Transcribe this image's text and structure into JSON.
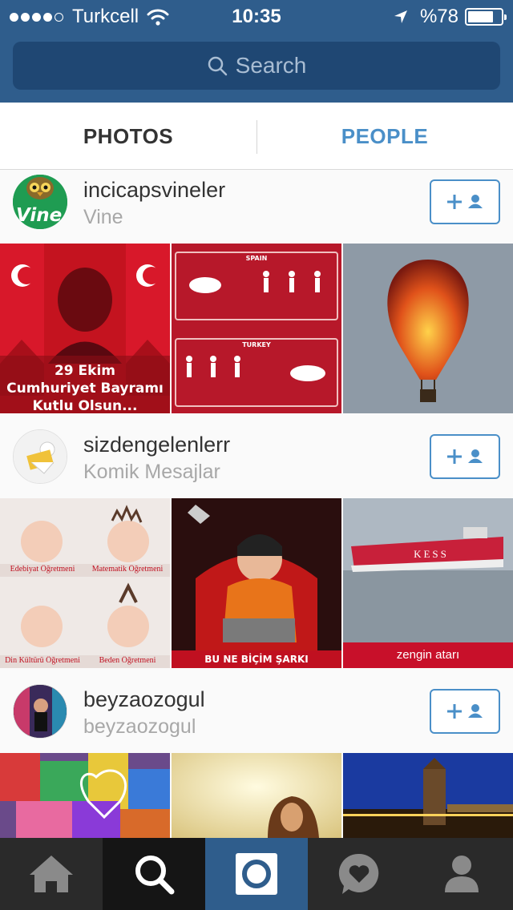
{
  "status_bar": {
    "carrier": "Turkcell",
    "time": "10:35",
    "battery": "%78",
    "battery_level": 0.78
  },
  "search": {
    "placeholder": "Search"
  },
  "tabs": [
    {
      "label": "PHOTOS",
      "active": false
    },
    {
      "label": "PEOPLE",
      "active": true
    }
  ],
  "users": [
    {
      "username": "incicapsvineler",
      "full_name": "Vine",
      "photos": [
        {
          "caption_lines": [
            "29 Ekim",
            "Cumhuriyet Bayramı",
            "Kutlu Olsun..."
          ]
        },
        {
          "labels": [
            "SPAIN",
            "TURKEY"
          ]
        },
        {
          "subject": "balloon"
        }
      ]
    },
    {
      "username": "sizdengelenlerr",
      "full_name": "Komik Mesajlar",
      "photos": [
        {
          "labels": [
            "Edebiyat Öğretmeni",
            "Matematik Öğretmeni",
            "Din Kültürü Öğretmeni",
            "Beden Öğretmeni"
          ]
        },
        {
          "caption": "BU NE BİÇİM ŞARKI"
        },
        {
          "ship_name": "KESS",
          "caption": "zengin atarı"
        }
      ]
    },
    {
      "username": "beyzaozogul",
      "full_name": "beyzaozogul",
      "photos": [
        {
          "subject": "graffiti"
        },
        {
          "subject": "portrait"
        },
        {
          "subject": "tower"
        }
      ]
    }
  ],
  "colors": {
    "header": "#2f5d8c",
    "accent": "#4a8fc8",
    "tabbar": "#2a2a2a"
  },
  "tabbar_icons": [
    "home-icon",
    "search-icon",
    "camera-icon",
    "news-icon",
    "profile-icon"
  ]
}
